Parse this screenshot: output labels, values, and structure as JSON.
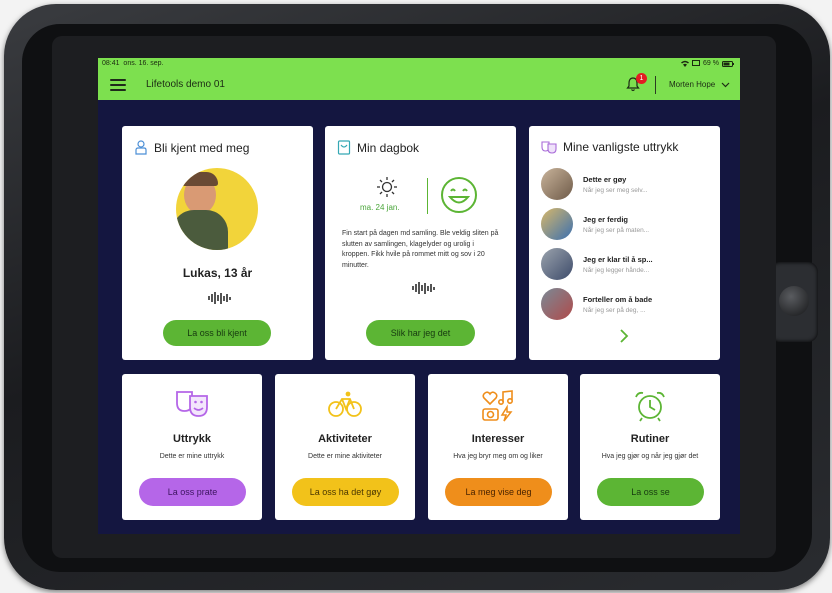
{
  "status": {
    "time": "08:41",
    "date": "ons. 16. sep.",
    "battery": "69 %"
  },
  "header": {
    "title": "Lifetools demo 01",
    "notifications": "1",
    "user": "Morten Hope"
  },
  "about": {
    "title": "Bli kjent med meg",
    "name": "Lukas, 13 år",
    "button": "La oss bli kjent"
  },
  "diary": {
    "title": "Min dagbok",
    "date": "ma. 24 jan.",
    "text": "Fin start på dagen md samling. Ble veldig sliten på slutten av samlingen, klagelyder og urolig i kroppen. Fikk hvile på rommet mitt og sov i 20 minutter.",
    "button": "Slik har jeg det"
  },
  "expressions": {
    "title": "Mine vanligste uttrykk",
    "items": [
      {
        "title": "Dette er gøy",
        "sub": "Når jeg ser meg selv..."
      },
      {
        "title": "Jeg er ferdig",
        "sub": "Når jeg ser på maten..."
      },
      {
        "title": "Jeg er klar til å sp...",
        "sub": "Når jeg legger hånde..."
      },
      {
        "title": "Forteller om å bade",
        "sub": "Når jeg ser på deg, ..."
      }
    ]
  },
  "tiles": [
    {
      "title": "Uttrykk",
      "sub": "Dette er mine uttrykk",
      "button": "La oss prate",
      "color": "#b566e8",
      "icon": "masks-icon"
    },
    {
      "title": "Aktiviteter",
      "sub": "Dette er mine aktiviteter",
      "button": "La oss ha det gøy",
      "color": "#f2c21a",
      "icon": "bicycle-icon"
    },
    {
      "title": "Interesser",
      "sub": "Hva jeg bryr meg om og liker",
      "button": "La meg vise deg",
      "color": "#ef8e1b",
      "icon": "interests-icon"
    },
    {
      "title": "Rutiner",
      "sub": "Hva jeg gjør og når jeg gjør det",
      "button": "La oss se",
      "color": "#5cb534",
      "icon": "alarm-clock-icon"
    }
  ]
}
